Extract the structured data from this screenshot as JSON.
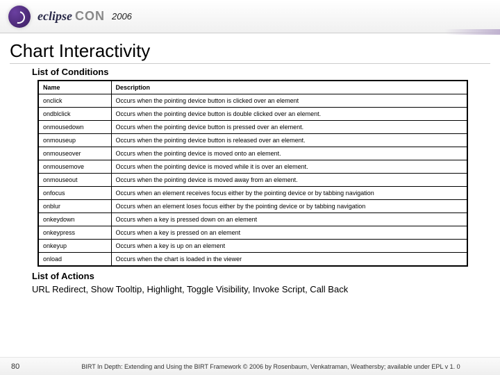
{
  "header": {
    "logo_eclipse": "eclipse",
    "logo_con": "CON",
    "year": "2006"
  },
  "title": "Chart Interactivity",
  "conditions": {
    "heading": "List of Conditions",
    "columns": {
      "name": "Name",
      "description": "Description"
    },
    "rows": [
      {
        "name": "onclick",
        "desc": "Occurs when the pointing device button is clicked over an element"
      },
      {
        "name": "ondblclick",
        "desc": "Occurs when the pointing device button is double clicked over an element."
      },
      {
        "name": "onmousedown",
        "desc": "Occurs when the pointing device button is pressed over an element."
      },
      {
        "name": "onmouseup",
        "desc": "Occurs when the pointing device button is released over an element."
      },
      {
        "name": "onmouseover",
        "desc": "Occurs when the pointing device is moved onto an element."
      },
      {
        "name": "onmousemove",
        "desc": "Occurs when the pointing device is moved while it is over an element."
      },
      {
        "name": "onmouseout",
        "desc": "Occurs when the pointing device is moved away from an element."
      },
      {
        "name": "onfocus",
        "desc": "Occurs when an element receives focus either by the pointing device or by tabbing navigation"
      },
      {
        "name": "onblur",
        "desc": "Occurs when an element loses focus either by the pointing device or by tabbing navigation"
      },
      {
        "name": "onkeydown",
        "desc": "Occurs when a key is pressed down on an element"
      },
      {
        "name": "onkeypress",
        "desc": "Occurs when a key is pressed on an element"
      },
      {
        "name": "onkeyup",
        "desc": "Occurs when a key is up on an element"
      },
      {
        "name": "onload",
        "desc": "Occurs when the chart is loaded in the viewer"
      }
    ]
  },
  "actions": {
    "heading": "List of Actions",
    "list": "URL Redirect, Show Tooltip, Highlight, Toggle Visibility, Invoke Script, Call Back"
  },
  "footer": {
    "page": "80",
    "text": "BIRT In Depth: Extending and Using the BIRT Framework © 2006 by Rosenbaum, Venkatraman, Weathersby; available under EPL v 1. 0"
  }
}
